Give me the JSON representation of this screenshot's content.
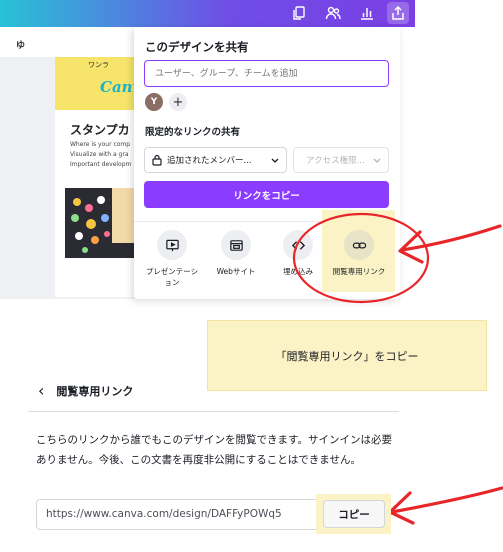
{
  "topbar": {
    "icons": [
      "copy-pages-icon",
      "people-icon",
      "analytics-icon",
      "share-icon"
    ],
    "gradient": [
      "#27c2d6",
      "#7b3fe4"
    ]
  },
  "editor": {
    "zoom_label": "ゆ",
    "design": {
      "brand_small": "ワンラ",
      "brand": "Canva",
      "title": "スタンプカ",
      "lines": [
        "Where is your comp",
        "Visualize with a gra",
        "Important developm"
      ]
    }
  },
  "share_panel": {
    "title": "このデザインを共有",
    "invite_placeholder": "ユーザー、グループ、チームを追加",
    "avatar_initial": "Y",
    "add_symbol": "+",
    "restricted_label": "限定的なリンクの共有",
    "audience_dropdown": "追加されたメンバー...",
    "access_dropdown": "アクセス権限...",
    "copy_link_button": "リンクをコピー",
    "options": [
      {
        "label": "プレゼンテーション",
        "icon": "presentation-icon"
      },
      {
        "label": "Webサイト",
        "icon": "website-icon"
      },
      {
        "label": "埋め込み",
        "icon": "embed-icon"
      },
      {
        "label": "閲覧専用リンク",
        "icon": "link-icon"
      }
    ]
  },
  "note": "「閲覧専用リンク」をコピー",
  "view_only": {
    "back_title": "閲覧専用リンク",
    "description": "こちらのリンクから誰でもこのデザインを閲覧できます。サインインは必要ありません。今後、この文書を再度非公開にすることはできません。",
    "url": "https://www.canva.com/design/DAFFyPOWq5",
    "copy_button": "コピー"
  },
  "colors": {
    "accent": "#8b3dff",
    "highlight": "#fbf2c6",
    "annotation": "#e8262a"
  }
}
